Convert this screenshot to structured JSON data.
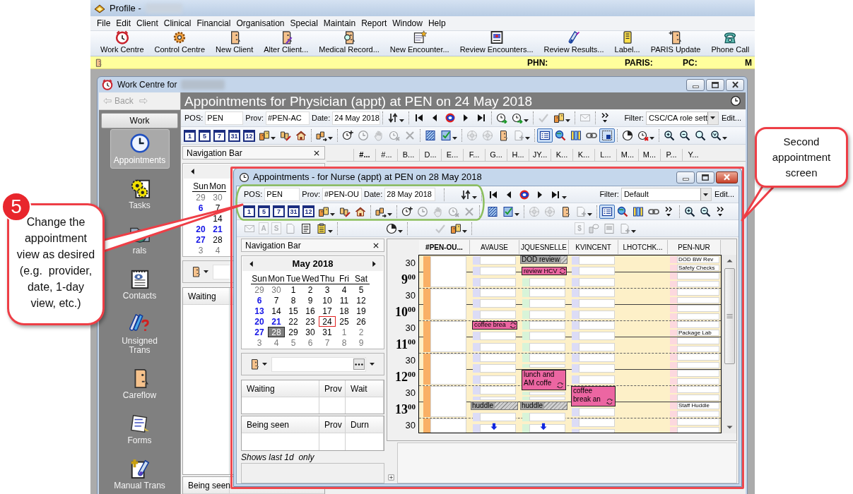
{
  "app": {
    "title": "Profile -",
    "menu": [
      "File",
      "Edit",
      "Client",
      "Clinical",
      "Financial",
      "Organisation",
      "Special",
      "Maintain",
      "Report",
      "Window",
      "Help"
    ],
    "toolbar": [
      {
        "kind": "red-clock",
        "label": "Work Centre"
      },
      {
        "kind": "gear",
        "label": "Control Centre"
      },
      {
        "kind": "face",
        "label": "New Client"
      },
      {
        "kind": "face-pencil",
        "label": "Alter Client..."
      },
      {
        "kind": "face-magnifier",
        "label": "Medical Record..."
      },
      {
        "kind": "doc-star",
        "label": "New Encounter..."
      },
      {
        "kind": "framed-doc",
        "label": "Review Encounters..."
      },
      {
        "kind": "test-tube",
        "label": "Review Results..."
      },
      {
        "kind": "label-roll",
        "label": "Label..."
      },
      {
        "kind": "face-badge",
        "label": "PARIS Update"
      },
      {
        "kind": "phone",
        "label": "Phone Call"
      }
    ],
    "patient_bar": [
      "PHN:",
      "PARIS:",
      "PC:",
      "M"
    ]
  },
  "work_centre": {
    "title": "Work Centre for",
    "back": {
      "label": "Back",
      "disabled": true
    },
    "section": "Work",
    "sidebar": [
      {
        "kind": "blue-clock",
        "label": "Appointments",
        "selected": true
      },
      {
        "kind": "gears",
        "label": "Tasks",
        "selected": false
      },
      {
        "kind": "globe-folder",
        "label": "rals",
        "selected": false
      },
      {
        "kind": "notepad",
        "label": "Contacts",
        "selected": false
      },
      {
        "kind": "tubes",
        "label": "Unsigned Trans",
        "selected": false
      },
      {
        "kind": "face",
        "label": "Careflow",
        "selected": false
      },
      {
        "kind": "form",
        "label": "Forms",
        "selected": false
      },
      {
        "kind": "tube-doc",
        "label": "Manual Trans",
        "selected": false
      }
    ],
    "header": "Appointments for Physician (appt) at PEN on 24 May 2018",
    "fields": [
      {
        "label": "POS:",
        "value": "PEN"
      },
      {
        "label": "Prov:",
        "value": "#PEN-AC"
      },
      {
        "label": "Date:",
        "value": "24 May 2018"
      }
    ],
    "toolbar_1": [
      [
        {
          "kind": "refresh",
          "disabled": false,
          "pressed": false,
          "dropdown": true
        }
      ],
      [
        {
          "kind": "first",
          "disabled": false,
          "pressed": false,
          "dropdown": false
        },
        {
          "kind": "prev",
          "disabled": false,
          "pressed": false,
          "dropdown": false
        },
        {
          "kind": "today",
          "disabled": false,
          "pressed": false,
          "dropdown": false
        },
        {
          "kind": "next",
          "disabled": false,
          "pressed": false,
          "dropdown": false
        },
        {
          "kind": "last",
          "disabled": false,
          "pressed": false,
          "dropdown": false
        }
      ],
      [
        {
          "kind": "clock-arrow",
          "disabled": false,
          "pressed": false,
          "dropdown": false
        },
        {
          "kind": "clock-arrow",
          "disabled": false,
          "pressed": false,
          "dropdown": true
        }
      ],
      [
        {
          "kind": "tick",
          "disabled": true,
          "pressed": false,
          "dropdown": false
        },
        {
          "kind": "people",
          "disabled": false,
          "pressed": false,
          "dropdown": true
        }
      ],
      [
        {
          "kind": "envelope",
          "disabled": true,
          "pressed": false,
          "dropdown": false
        }
      ],
      [
        {
          "kind": "more",
          "disabled": false,
          "pressed": false,
          "dropdown": false
        }
      ]
    ],
    "filter": {
      "label": "Filter:",
      "value": "CSC/CA role sett"
    },
    "edit": "Edit...",
    "toolbar_2": [
      [
        {
          "kind": "calendar",
          "label": "1",
          "disabled": false,
          "pressed": false,
          "dropdown": false
        },
        {
          "kind": "calendar",
          "label": "5",
          "disabled": false,
          "pressed": false,
          "dropdown": false
        },
        {
          "kind": "calendar",
          "label": "7",
          "disabled": false,
          "pressed": false,
          "dropdown": false
        },
        {
          "kind": "calendar",
          "label": "31",
          "disabled": false,
          "pressed": false,
          "dropdown": false
        },
        {
          "kind": "calendar",
          "label": "12",
          "disabled": false,
          "pressed": false,
          "dropdown": false
        },
        {
          "kind": "people",
          "disabled": false,
          "pressed": false,
          "dropdown": true
        },
        {
          "kind": "people-pencil",
          "disabled": false,
          "pressed": false,
          "dropdown": false
        },
        {
          "kind": "house",
          "disabled": false,
          "pressed": false,
          "dropdown": false
        }
      ],
      [
        {
          "kind": "people-arrow",
          "disabled": false,
          "pressed": false,
          "dropdown": true
        }
      ],
      [
        {
          "kind": "clock-plus",
          "disabled": false,
          "pressed": false,
          "dropdown": false
        },
        {
          "kind": "clock",
          "disabled": true,
          "pressed": false,
          "dropdown": false
        },
        {
          "kind": "hand",
          "disabled": true,
          "pressed": false,
          "dropdown": false
        },
        {
          "kind": "clock-cross",
          "disabled": true,
          "pressed": false,
          "dropdown": false
        },
        {
          "kind": "cross",
          "disabled": true,
          "pressed": false,
          "dropdown": false
        }
      ],
      [
        {
          "kind": "hatched-doc",
          "disabled": false,
          "pressed": false,
          "dropdown": false
        },
        {
          "kind": "checked-doc",
          "disabled": false,
          "pressed": false,
          "dropdown": true
        }
      ],
      [
        {
          "kind": "dial",
          "disabled": true,
          "pressed": false,
          "dropdown": false
        },
        {
          "kind": "dial",
          "disabled": true,
          "pressed": false,
          "dropdown": false
        },
        {
          "kind": "face",
          "disabled": false,
          "pressed": false,
          "dropdown": false
        },
        {
          "kind": "doc-plus",
          "disabled": true,
          "pressed": false,
          "dropdown": true
        }
      ],
      [
        {
          "kind": "list-view",
          "disabled": false,
          "pressed": true,
          "dropdown": false
        },
        {
          "kind": "globe-magnifier",
          "disabled": false,
          "pressed": false,
          "dropdown": false
        },
        {
          "kind": "columns",
          "disabled": false,
          "pressed": false,
          "dropdown": false
        },
        {
          "kind": "link",
          "disabled": false,
          "pressed": false,
          "dropdown": false
        },
        {
          "kind": "selection",
          "disabled": false,
          "pressed": true,
          "dropdown": false
        }
      ],
      [
        {
          "kind": "pie",
          "disabled": false,
          "pressed": false,
          "dropdown": false
        },
        {
          "kind": "clock-cross-red",
          "disabled": false,
          "pressed": false,
          "dropdown": true
        }
      ],
      [
        {
          "kind": "zoom-in",
          "disabled": false,
          "pressed": false,
          "dropdown": false
        },
        {
          "kind": "zoom-out",
          "disabled": false,
          "pressed": false,
          "dropdown": false
        },
        {
          "kind": "zoom-fit",
          "disabled": false,
          "pressed": false,
          "dropdown": false
        },
        {
          "kind": "zoom-down",
          "disabled": false,
          "pressed": false,
          "dropdown": true
        }
      ]
    ],
    "navigation": {
      "title": "Navigation Bar",
      "weekdays": [
        "Sun",
        "Mon"
      ],
      "weeks": [
        {
          "sun": {
            "day": "29",
            "kind": "other",
            "today": false,
            "selected": false
          },
          "mon": {
            "day": "30",
            "kind": "other",
            "today": false,
            "selected": false
          }
        },
        {
          "sun": {
            "day": "6",
            "kind": "nonworking",
            "today": false,
            "selected": false
          },
          "mon": {
            "day": "7",
            "kind": "normal",
            "today": false,
            "selected": false
          }
        },
        {
          "mon": {
            "day": "14",
            "kind": "normal",
            "today": false,
            "selected": false
          }
        },
        {
          "sun": {
            "day": "20",
            "kind": "nonworking",
            "today": false,
            "selected": false
          },
          "mon": {
            "day": "21",
            "kind": "nonworking",
            "today": false,
            "selected": false
          }
        },
        {
          "sun": {
            "day": "27",
            "kind": "nonworking",
            "today": false,
            "selected": false
          },
          "mon": {
            "day": "28",
            "kind": "normal",
            "today": false,
            "selected": false
          }
        },
        {
          "sun": {
            "day": "3",
            "kind": "other",
            "today": false,
            "selected": false
          },
          "mon": {
            "day": "4",
            "kind": "other",
            "today": false,
            "selected": false
          }
        }
      ]
    },
    "lists": [
      "Waiting",
      "Being seen"
    ],
    "columns": [
      {
        "name": "#...",
        "selected": true
      },
      {
        "name": "#...",
        "selected": false
      },
      {
        "name": "B...",
        "selected": false
      },
      {
        "name": "D...",
        "selected": false
      },
      {
        "name": "E...",
        "selected": false
      },
      {
        "name": "F...",
        "selected": false
      },
      {
        "name": "G...",
        "selected": false
      },
      {
        "name": "H...",
        "selected": false
      },
      {
        "name": "JY...",
        "selected": false
      },
      {
        "name": "K...",
        "selected": false
      },
      {
        "name": "K...",
        "selected": false
      },
      {
        "name": "L...",
        "selected": false
      },
      {
        "name": "M...",
        "selected": false
      },
      {
        "name": "M...",
        "selected": false
      },
      {
        "name": "P...",
        "selected": false
      },
      {
        "name": "Y...",
        "selected": false
      }
    ]
  },
  "appointments_window": {
    "title": "Appointments - for Nurse (appt) at PEN on 28 May 2018",
    "fields": [
      {
        "label": "POS:",
        "value": "PEN"
      },
      {
        "label": "Prov:",
        "value": "#PEN-OU"
      },
      {
        "label": "Date:",
        "value": "28 May 2018"
      }
    ],
    "toolbar_1": [
      [
        {
          "kind": "refresh",
          "disabled": false,
          "pressed": false,
          "dropdown": true
        }
      ],
      [
        {
          "kind": "first",
          "disabled": false,
          "pressed": false,
          "dropdown": false
        },
        {
          "kind": "prev",
          "disabled": false,
          "pressed": false,
          "dropdown": false
        },
        {
          "kind": "today",
          "disabled": false,
          "pressed": false,
          "dropdown": false
        },
        {
          "kind": "next",
          "disabled": false,
          "pressed": false,
          "dropdown": false
        },
        {
          "kind": "last",
          "disabled": false,
          "pressed": false,
          "dropdown": true
        }
      ]
    ],
    "filter": {
      "label": "Filter:",
      "value": "Default"
    },
    "edit": "Edit...",
    "toolbar_2": [
      [
        {
          "kind": "calendar",
          "label": "1",
          "disabled": false,
          "pressed": false,
          "dropdown": false
        },
        {
          "kind": "calendar",
          "label": "5",
          "disabled": false,
          "pressed": false,
          "dropdown": false
        },
        {
          "kind": "calendar",
          "label": "7",
          "disabled": false,
          "pressed": false,
          "dropdown": false
        },
        {
          "kind": "calendar",
          "label": "31",
          "disabled": false,
          "pressed": false,
          "dropdown": false
        },
        {
          "kind": "calendar",
          "label": "12",
          "disabled": false,
          "pressed": false,
          "dropdown": false
        },
        {
          "kind": "people",
          "disabled": false,
          "pressed": false,
          "dropdown": true
        },
        {
          "kind": "people-pencil",
          "disabled": false,
          "pressed": false,
          "dropdown": false
        },
        {
          "kind": "house",
          "disabled": false,
          "pressed": false,
          "dropdown": false
        }
      ],
      [
        {
          "kind": "people-arrow",
          "disabled": false,
          "pressed": false,
          "dropdown": true
        }
      ],
      [
        {
          "kind": "clock-plus",
          "disabled": false,
          "pressed": false,
          "dropdown": false
        },
        {
          "kind": "clock",
          "disabled": true,
          "pressed": false,
          "dropdown": false
        },
        {
          "kind": "hand",
          "disabled": true,
          "pressed": false,
          "dropdown": false
        },
        {
          "kind": "clock-cross",
          "disabled": true,
          "pressed": false,
          "dropdown": false
        },
        {
          "kind": "cross",
          "disabled": true,
          "pressed": false,
          "dropdown": false
        }
      ],
      [
        {
          "kind": "hatched-doc",
          "disabled": false,
          "pressed": false,
          "dropdown": false
        },
        {
          "kind": "checked-doc",
          "disabled": false,
          "pressed": false,
          "dropdown": true
        }
      ],
      [
        {
          "kind": "dial",
          "disabled": true,
          "pressed": false,
          "dropdown": false
        },
        {
          "kind": "dial",
          "disabled": true,
          "pressed": false,
          "dropdown": false
        },
        {
          "kind": "face",
          "disabled": false,
          "pressed": false,
          "dropdown": false
        },
        {
          "kind": "doc-plus",
          "disabled": true,
          "pressed": false,
          "dropdown": true
        }
      ],
      [
        {
          "kind": "list-view",
          "disabled": false,
          "pressed": true,
          "dropdown": false
        },
        {
          "kind": "globe-magnifier",
          "disabled": false,
          "pressed": false,
          "dropdown": false
        },
        {
          "kind": "columns",
          "disabled": false,
          "pressed": false,
          "dropdown": false
        },
        {
          "kind": "link",
          "disabled": false,
          "pressed": false,
          "dropdown": false
        },
        {
          "kind": "more",
          "disabled": false,
          "pressed": false,
          "dropdown": false
        }
      ],
      [
        {
          "kind": "zoom-in",
          "disabled": false,
          "pressed": false,
          "dropdown": false
        },
        {
          "kind": "zoom-out",
          "disabled": false,
          "pressed": false,
          "dropdown": false
        },
        {
          "kind": "more",
          "disabled": false,
          "pressed": false,
          "dropdown": false
        }
      ]
    ],
    "toolbar_3": [
      [
        {
          "kind": "envelope",
          "disabled": true,
          "pressed": false,
          "dropdown": false
        },
        {
          "kind": "letter",
          "label": "A",
          "disabled": true,
          "pressed": false,
          "dropdown": false
        },
        {
          "kind": "letter",
          "label": "S",
          "disabled": true,
          "pressed": false,
          "dropdown": false
        },
        {
          "kind": "doc",
          "disabled": true,
          "pressed": false,
          "dropdown": false
        },
        {
          "kind": "text-doc",
          "disabled": false,
          "pressed": false,
          "dropdown": false
        },
        {
          "kind": "clipboard",
          "disabled": false,
          "pressed": false,
          "dropdown": true
        }
      ],
      [
        {
          "kind": "pie",
          "disabled": false,
          "pressed": false,
          "dropdown": true
        }
      ],
      [
        {
          "kind": "tick",
          "disabled": true,
          "pressed": false,
          "dropdown": false
        },
        {
          "kind": "people",
          "disabled": false,
          "pressed": false,
          "dropdown": true
        }
      ],
      [
        {
          "kind": "letter",
          "label": "$",
          "disabled": true,
          "pressed": false,
          "dropdown": false
        },
        {
          "kind": "people-speech",
          "disabled": true,
          "pressed": false,
          "dropdown": false
        },
        {
          "kind": "image-doc",
          "disabled": true,
          "pressed": false,
          "dropdown": false
        },
        {
          "kind": "doc-plus",
          "disabled": true,
          "pressed": false,
          "dropdown": true
        }
      ]
    ],
    "navigation": {
      "title": "Navigation Bar",
      "month": "May 2018",
      "weekdays": [
        "Sun",
        "Mon",
        "Tue",
        "Wed",
        "Thu",
        "Fri",
        "Sat"
      ],
      "weeks": [
        [
          {
            "day": "29",
            "kind": "other",
            "today": false,
            "selected": false
          },
          {
            "day": "30",
            "kind": "other",
            "today": false,
            "selected": false
          },
          {
            "day": "1",
            "kind": "normal",
            "today": false,
            "selected": false
          },
          {
            "day": "2",
            "kind": "normal",
            "today": false,
            "selected": false
          },
          {
            "day": "3",
            "kind": "normal",
            "today": false,
            "selected": false
          },
          {
            "day": "4",
            "kind": "normal",
            "today": false,
            "selected": false
          },
          {
            "day": "5",
            "kind": "normal",
            "today": false,
            "selected": false
          }
        ],
        [
          {
            "day": "6",
            "kind": "nonworking",
            "today": false,
            "selected": false
          },
          {
            "day": "7",
            "kind": "normal",
            "today": false,
            "selected": false
          },
          {
            "day": "8",
            "kind": "normal",
            "today": false,
            "selected": false
          },
          {
            "day": "9",
            "kind": "normal",
            "today": false,
            "selected": false
          },
          {
            "day": "10",
            "kind": "normal",
            "today": false,
            "selected": false
          },
          {
            "day": "11",
            "kind": "normal",
            "today": false,
            "selected": false
          },
          {
            "day": "12",
            "kind": "normal",
            "today": false,
            "selected": false
          }
        ],
        [
          {
            "day": "13",
            "kind": "nonworking",
            "today": false,
            "selected": false
          },
          {
            "day": "14",
            "kind": "normal",
            "today": false,
            "selected": false
          },
          {
            "day": "15",
            "kind": "normal",
            "today": false,
            "selected": false
          },
          {
            "day": "16",
            "kind": "normal",
            "today": false,
            "selected": false
          },
          {
            "day": "17",
            "kind": "normal",
            "today": false,
            "selected": false
          },
          {
            "day": "18",
            "kind": "normal",
            "today": false,
            "selected": false
          },
          {
            "day": "19",
            "kind": "normal",
            "today": false,
            "selected": false
          }
        ],
        [
          {
            "day": "20",
            "kind": "nonworking",
            "today": false,
            "selected": false
          },
          {
            "day": "21",
            "kind": "nonworking",
            "today": false,
            "selected": false
          },
          {
            "day": "22",
            "kind": "normal",
            "today": false,
            "selected": false
          },
          {
            "day": "23",
            "kind": "normal",
            "today": false,
            "selected": false
          },
          {
            "day": "24",
            "kind": "normal",
            "today": true,
            "selected": false
          },
          {
            "day": "25",
            "kind": "normal",
            "today": false,
            "selected": false
          },
          {
            "day": "26",
            "kind": "normal",
            "today": false,
            "selected": false
          }
        ],
        [
          {
            "day": "27",
            "kind": "nonworking",
            "today": false,
            "selected": false
          },
          {
            "day": "28",
            "kind": "normal",
            "today": false,
            "selected": true
          },
          {
            "day": "29",
            "kind": "normal",
            "today": false,
            "selected": false
          },
          {
            "day": "30",
            "kind": "normal",
            "today": false,
            "selected": false
          },
          {
            "day": "31",
            "kind": "normal",
            "today": false,
            "selected": false
          },
          {
            "day": "1",
            "kind": "other",
            "today": false,
            "selected": false
          },
          {
            "day": "2",
            "kind": "other",
            "today": false,
            "selected": false
          }
        ],
        [
          {
            "day": "3",
            "kind": "other",
            "today": false,
            "selected": false
          },
          {
            "day": "4",
            "kind": "other",
            "today": false,
            "selected": false
          },
          {
            "day": "5",
            "kind": "other",
            "today": false,
            "selected": false
          },
          {
            "day": "6",
            "kind": "other",
            "today": false,
            "selected": false
          },
          {
            "day": "7",
            "kind": "other",
            "today": false,
            "selected": false
          },
          {
            "day": "8",
            "kind": "other",
            "today": false,
            "selected": false
          },
          {
            "day": "9",
            "kind": "other",
            "today": false,
            "selected": false
          }
        ]
      ]
    },
    "lists": [
      {
        "columns": [
          "Waiting",
          "Prov",
          "Wait"
        ]
      },
      {
        "columns": [
          "Being seen",
          "Prov",
          "Durn"
        ]
      }
    ],
    "note": "Shows last 1d  only",
    "schedule": {
      "times": [
        {
          "kind": "half",
          "text": "30"
        },
        {
          "kind": "hour",
          "text": "9$^{00}$"
        },
        {
          "kind": "half",
          "text": "30"
        },
        {
          "kind": "hour",
          "text": "10$^{00}$"
        },
        {
          "kind": "half",
          "text": "30"
        },
        {
          "kind": "hour",
          "text": "11$^{00}$"
        },
        {
          "kind": "half",
          "text": "30"
        },
        {
          "kind": "hour",
          "text": "12$^{00}$"
        },
        {
          "kind": "half",
          "text": "30"
        },
        {
          "kind": "hour",
          "text": "13$^{00}$"
        },
        {
          "kind": "half",
          "text": "30"
        }
      ],
      "columns": [
        {
          "name": "#PEN-OU...",
          "selected": true,
          "color": "#f9b066",
          "more_below": false,
          "slots": [
            {
              "kind": "hour"
            },
            {
              "kind": "hour"
            },
            {
              "kind": "hour"
            },
            {
              "kind": "hour"
            },
            {
              "kind": "hour"
            },
            {
              "kind": "hour"
            }
          ]
        },
        {
          "name": "AVAUSE",
          "selected": false,
          "color": "#dcdcf6",
          "more_below": true,
          "slots": [
            {
              "kind": "free"
            },
            {
              "kind": "free"
            },
            {
              "kind": "free"
            },
            {
              "kind": "free"
            },
            {
              "kind": "free"
            },
            {
              "kind": "free"
            },
            {
              "kind": "booked",
              "text": "coffee brea"
            },
            {
              "kind": "free"
            },
            {
              "kind": "free"
            },
            {
              "kind": "free"
            },
            {
              "kind": "free"
            },
            {
              "kind": "free"
            },
            {
              "kind": "free"
            },
            {
              "kind": "half"
            },
            {
              "kind": "blocked",
              "text": "huddle"
            },
            {
              "kind": "free"
            },
            {
              "kind": "free"
            },
            {
              "kind": "free"
            }
          ]
        },
        {
          "name": "JQUESNELLE",
          "selected": false,
          "color": "#d8f4d8",
          "more_below": true,
          "slots": [
            {
              "kind": "blocked",
              "text": "DOD review"
            },
            {
              "kind": "booked",
              "text": "review HCV"
            },
            {
              "kind": "free"
            },
            {
              "kind": "free"
            },
            {
              "kind": "free"
            },
            {
              "kind": "free"
            },
            {
              "kind": "free"
            },
            {
              "kind": "free"
            },
            {
              "kind": "free"
            },
            {
              "kind": "free"
            },
            {
              "kind": "half"
            },
            {
              "kind": "long",
              "text": "lunch and AM coffe"
            },
            {
              "kind": "half"
            },
            {
              "kind": "half"
            },
            {
              "kind": "blocked",
              "text": "huddle"
            },
            {
              "kind": "free"
            },
            {
              "kind": "free"
            },
            {
              "kind": "free"
            }
          ]
        },
        {
          "name": "KVINCENT",
          "selected": false,
          "color": "#dcdcf6",
          "more_below": false,
          "slots": [
            {
              "kind": "free"
            },
            {
              "kind": "free"
            },
            {
              "kind": "free"
            },
            {
              "kind": "free"
            },
            {
              "kind": "free"
            },
            {
              "kind": "free"
            },
            {
              "kind": "free"
            },
            {
              "kind": "free"
            },
            {
              "kind": "free"
            },
            {
              "kind": "free"
            },
            {
              "kind": "free"
            },
            {
              "kind": "free"
            },
            {
              "kind": "long",
              "text": "coffee break an"
            },
            {
              "kind": "free"
            },
            {
              "kind": "free"
            },
            {
              "kind": "free"
            }
          ]
        },
        {
          "name": "LHOTCHK...",
          "selected": false,
          "more_below": false
        },
        {
          "name": "PEN-NUR",
          "selected": false,
          "color": "#fcd8de",
          "more_below": false,
          "slots": [
            {
              "kind": "quarter",
              "text": "DOD BW Rev"
            },
            {
              "kind": "quarter",
              "text": "Safety Checks"
            },
            {
              "kind": "quarter"
            },
            {
              "kind": "quarter"
            },
            {
              "kind": "quarter"
            },
            {
              "kind": "quarter"
            },
            {
              "kind": "quarter"
            },
            {
              "kind": "quarter"
            },
            {
              "kind": "quarter"
            },
            {
              "kind": "quarter",
              "text": "Package Lab"
            },
            {
              "kind": "quarter"
            },
            {
              "kind": "quarter"
            },
            {
              "kind": "quarter"
            },
            {
              "kind": "quarter"
            },
            {
              "kind": "quarter"
            },
            {
              "kind": "quarter"
            },
            {
              "kind": "quarter"
            },
            {
              "kind": "quarter"
            },
            {
              "kind": "quarter",
              "text": "Staff Huddle"
            },
            {
              "kind": "quarter"
            },
            {
              "kind": "quarter"
            },
            {
              "kind": "quarter"
            }
          ]
        }
      ]
    }
  },
  "callouts": [
    {
      "kind": "step",
      "badge": "5",
      "lines": [
        "Change the",
        "appointment",
        "view as desired",
        "(e.g.  provider,",
        "date, 1-day",
        "view, etc.)"
      ]
    },
    {
      "kind": "note",
      "lines": [
        "Second",
        "appointment",
        "screen"
      ]
    }
  ]
}
